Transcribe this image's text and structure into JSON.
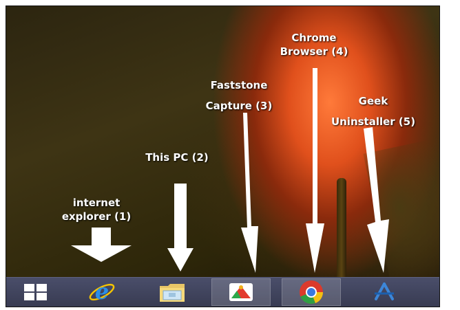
{
  "annotations": [
    {
      "line1": "internet",
      "line2": "explorer (1)"
    },
    {
      "line1": "This PC (2)"
    },
    {
      "line1": "Faststone",
      "line2": "Capture (3)"
    },
    {
      "line1": "Chrome",
      "line2": "Browser (4)"
    },
    {
      "line1": "Geek",
      "line2": "Uninstaller (5)"
    }
  ],
  "taskbar": {
    "items": [
      {
        "icon": "windows-start-icon",
        "active": false
      },
      {
        "icon": "internet-explorer-icon",
        "active": false
      },
      {
        "icon": "file-explorer-folder-icon",
        "active": false
      },
      {
        "icon": "faststone-capture-icon",
        "active": true
      },
      {
        "icon": "chrome-icon",
        "active": true
      },
      {
        "icon": "geek-uninstaller-icon",
        "active": false
      }
    ]
  },
  "colors": {
    "arrow": "#ffffff",
    "taskbar": "#3f4259",
    "tulip": "#e0501c"
  }
}
